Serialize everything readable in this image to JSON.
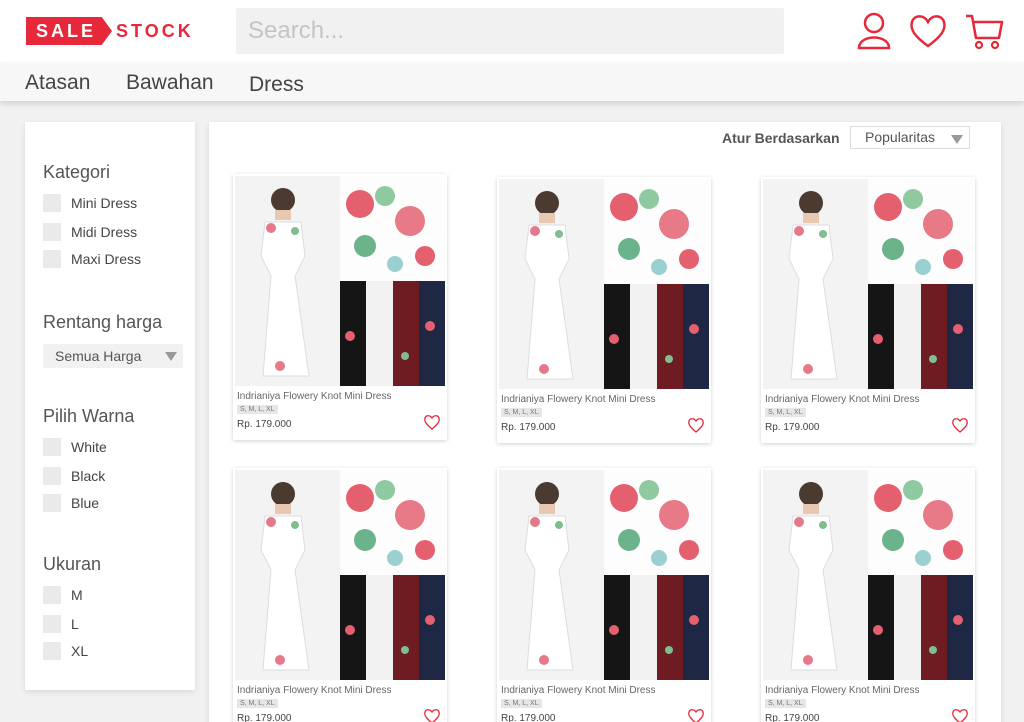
{
  "brand": {
    "part1": "SALE",
    "part2": "STOCK",
    "color": "#e6283a"
  },
  "search": {
    "placeholder": "Search..."
  },
  "header_icons": [
    "user-icon",
    "heart-icon",
    "cart-icon"
  ],
  "nav": {
    "items": [
      "Atasan",
      "Bawahan",
      "Dress"
    ]
  },
  "filters": {
    "category": {
      "title": "Kategori",
      "options": [
        "Mini Dress",
        "Midi Dress",
        "Maxi Dress"
      ]
    },
    "price": {
      "title": "Rentang harga",
      "selected": "Semua Harga"
    },
    "color": {
      "title": "Pilih Warna",
      "options": [
        "White",
        "Black",
        "Blue"
      ]
    },
    "size": {
      "title": "Ukuran",
      "options": [
        "M",
        "L",
        "XL"
      ]
    }
  },
  "sort": {
    "label": "Atur Berdasarkan",
    "selected": "Popularitas"
  },
  "products": [
    {
      "name": "Indrianiya Flowery Knot Mini Dress",
      "sizes": "S, M, L, XL",
      "price": "Rp. 179.000"
    },
    {
      "name": "Indrianiya Flowery Knot Mini Dress",
      "sizes": "S, M, L, XL",
      "price": "Rp. 179.000"
    },
    {
      "name": "Indrianiya Flowery Knot Mini Dress",
      "sizes": "S, M, L, XL",
      "price": "Rp. 179.000"
    },
    {
      "name": "Indrianiya Flowery Knot Mini Dress",
      "sizes": "S, M, L, XL",
      "price": "Rp. 179.000"
    },
    {
      "name": "Indrianiya Flowery Knot Mini Dress",
      "sizes": "S, M, L, XL",
      "price": "Rp. 179.000"
    },
    {
      "name": "Indrianiya Flowery Knot Mini Dress",
      "sizes": "S, M, L, XL",
      "price": "Rp. 179.000"
    }
  ]
}
